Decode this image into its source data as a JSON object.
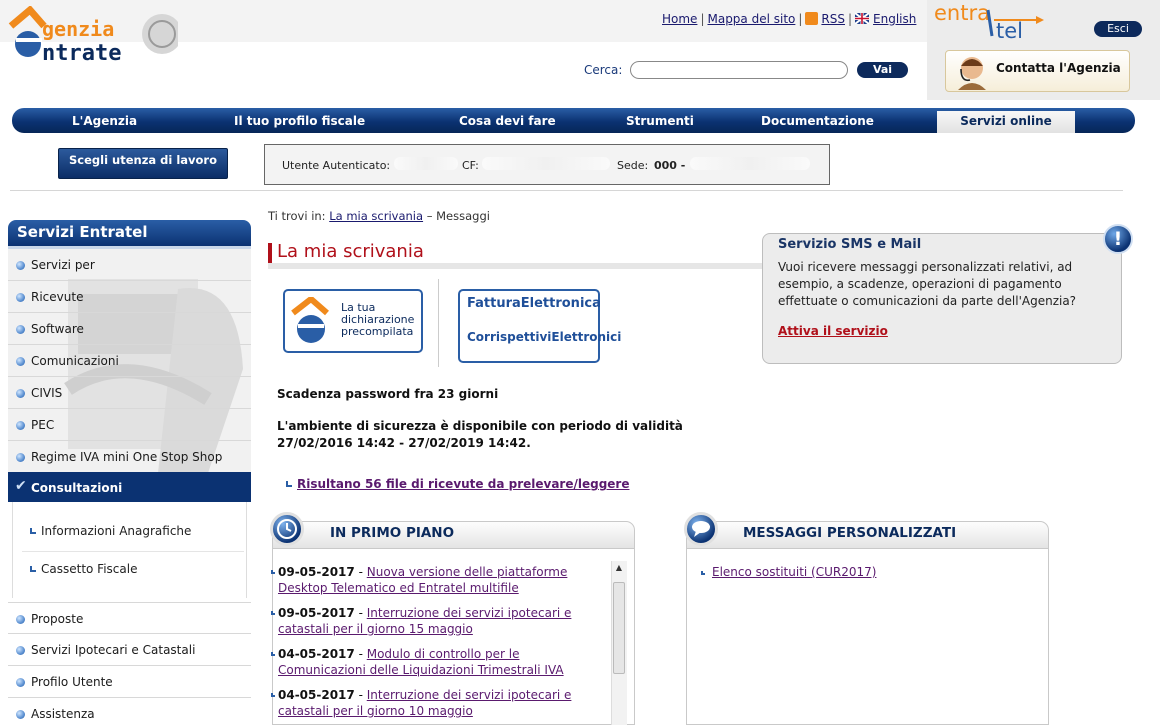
{
  "header": {
    "logo_line1": "genzia",
    "logo_line2": "ntrate",
    "links": [
      "Home",
      "Mappa del sito",
      "RSS",
      "English"
    ],
    "entratel_logo_top": "entra",
    "entratel_logo_bottom": "tel",
    "esci_label": "Esci",
    "search_label": "Cerca:",
    "search_value": "",
    "search_button": "Vai",
    "contact_label": "Contatta l'Agenzia"
  },
  "nav": {
    "items": [
      "L'Agenzia",
      "Il tuo profilo fiscale",
      "Cosa devi fare",
      "Strumenti",
      "Documentazione",
      "Servizi online"
    ],
    "active": "Servizi online"
  },
  "user_bar": {
    "choose_button": "Scegli utenza di lavoro",
    "user_label": "Utente Autenticato:",
    "cf_label": "CF:",
    "sede_label": "Sede:",
    "sede_value": "000 -"
  },
  "sidebar": {
    "title": "Servizi Entratel",
    "items_top": [
      "Servizi per",
      "Ricevute",
      "Software",
      "Comunicazioni",
      "CIVIS",
      "PEC",
      "Regime IVA mini One Stop Shop"
    ],
    "active": "Consultazioni",
    "sub_items": [
      "Informazioni Anagrafiche",
      "Cassetto Fiscale"
    ],
    "items_bottom": [
      "Proposte",
      "Servizi Ipotecari e Catastali",
      "Profilo Utente",
      "Assistenza"
    ]
  },
  "breadcrumb": {
    "prefix": "Ti trovi in:",
    "link": "La mia scrivania",
    "sep": "–",
    "current": "Messaggi"
  },
  "main": {
    "title": "La mia scrivania",
    "badge1": "La tua dichiarazione precompilata",
    "badge2_line1": "FatturaElettronica",
    "badge2_line2": "CorrispettiviElettronici",
    "password_notice": "Scadenza password fra 23 giorni",
    "security_line1": "L'ambiente di sicurezza è disponibile con periodo di validità",
    "security_line2": "27/02/2016 14:42 - 27/02/2019 14:42.",
    "receipts_link": "Risultano 56 file di ricevute da prelevare/leggere"
  },
  "sms_panel": {
    "title": "Servizio SMS e Mail",
    "text": "Vuoi ricevere messaggi personalizzati relativi, ad esempio, a scadenze, operazioni di pagamento effettuate o comunicazioni da parte dell'Agenzia?",
    "link": "Attiva il servizio"
  },
  "primo_piano": {
    "title": "IN PRIMO PIANO",
    "news": [
      {
        "date": "09-05-2017",
        "text": "Nuova versione delle piattaforme Desktop Telematico ed Entratel multifile"
      },
      {
        "date": "09-05-2017",
        "text": "Interruzione dei servizi ipotecari e catastali per il giorno 15 maggio"
      },
      {
        "date": "04-05-2017",
        "text": "Modulo di controllo per le Comunicazioni delle Liquidazioni Trimestrali IVA"
      },
      {
        "date": "04-05-2017",
        "text": "Interruzione dei servizi ipotecari e catastali per il giorno 10 maggio"
      }
    ]
  },
  "messaggi": {
    "title": "MESSAGGI PERSONALIZZATI",
    "items": [
      "Elenco sostituiti (CUR2017)"
    ]
  }
}
